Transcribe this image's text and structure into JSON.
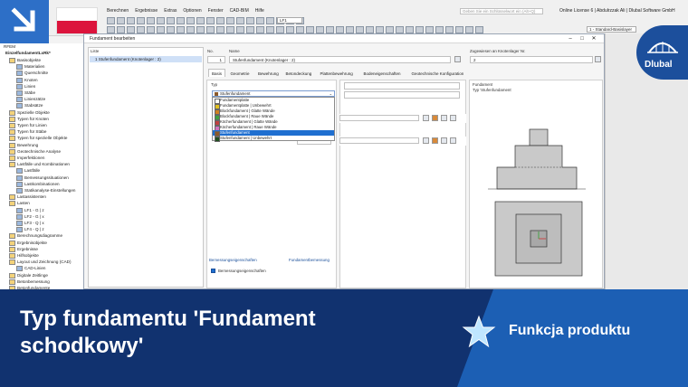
{
  "app": {
    "title": "RFEM",
    "menu": [
      "Berechnen",
      "Ergebnisse",
      "Extras",
      "Optionen",
      "Fenster",
      "CAD-BIM",
      "Hilfe"
    ],
    "search_placeholder": "Geben Sie ein Schlüsselwort ein (Alt+Q)",
    "licence": "Online License 6 | Abdulrzzak Ali | Dlubal Software GmbH",
    "loadcase": "LF1",
    "view_combo": "1 - Standard-Basislayer"
  },
  "colors": {
    "flag_white": "#ffffff",
    "flag_red": "#dc143c",
    "banner_dark": "#11326f",
    "banner_blue": "#1c5fb4",
    "selection": "#1f6fd0"
  },
  "navigator": {
    "root": "RFEM",
    "project": "EinzelfundamentLxRk*",
    "items": [
      {
        "label": "Basisobjekte",
        "level": 1
      },
      {
        "label": "Materialien",
        "level": 2
      },
      {
        "label": "Querschnitte",
        "level": 2
      },
      {
        "label": "Knoten",
        "level": 2
      },
      {
        "label": "Linien",
        "level": 2
      },
      {
        "label": "Stäbe",
        "level": 2
      },
      {
        "label": "Linienzätze",
        "level": 2
      },
      {
        "label": "Stabsätze",
        "level": 2
      },
      {
        "label": "Spezielle Objekte",
        "level": 1
      },
      {
        "label": "Typen für Knoten",
        "level": 1
      },
      {
        "label": "Typen für Linien",
        "level": 1
      },
      {
        "label": "Typen für Stäbe",
        "level": 1
      },
      {
        "label": "Typen für spezielle Objekte",
        "level": 1
      },
      {
        "label": "Bewehrung",
        "level": 1
      },
      {
        "label": "Geotechnische Analyse",
        "level": 1
      },
      {
        "label": "Imperfektionen",
        "level": 1
      },
      {
        "label": "Lastfälle und Kombinationen",
        "level": 1
      },
      {
        "label": "Lastfälle",
        "level": 2
      },
      {
        "label": "Bemessungssituationen",
        "level": 2
      },
      {
        "label": "Lastkombinationen",
        "level": 2
      },
      {
        "label": "Statikanalyse-Einstellungen",
        "level": 2
      },
      {
        "label": "Lastassistenten",
        "level": 1
      },
      {
        "label": "Lasten",
        "level": 1
      },
      {
        "label": "LF1 - G | z",
        "level": 2
      },
      {
        "label": "LF2 - G | x",
        "level": 2
      },
      {
        "label": "LF3 - Q | x",
        "level": 2
      },
      {
        "label": "LF4 - Q | z",
        "level": 2
      },
      {
        "label": "Berechnungsdiagramme",
        "level": 1
      },
      {
        "label": "Ergebnisobjekte",
        "level": 1
      },
      {
        "label": "Ergebnisse",
        "level": 1
      },
      {
        "label": "Hilfsobjekte",
        "level": 1
      },
      {
        "label": "Layout und Zeichnung (CAD)",
        "level": 1
      },
      {
        "label": "CAD-Linien",
        "level": 2
      },
      {
        "label": "Digitale Zeitlinge",
        "level": 1
      },
      {
        "label": "Betonbemessung",
        "level": 1
      },
      {
        "label": "Betonfundamente",
        "level": 1
      }
    ]
  },
  "dialog": {
    "title": "Fundament bearbeiten",
    "list_header": "Liste",
    "list_item": "1  Stufenfundament (Knotenlager : 2)",
    "no_label": "No.",
    "no_value": "1",
    "name_label": "Name",
    "name_value": "Stufenfundament (Knotenlager : 2)",
    "assigned_label": "Zugewiesen an Knotenlager Nr.",
    "assigned_value": "2",
    "tabs": [
      "Basis",
      "Geometrie",
      "Bewehrung",
      "Betondeckung",
      "Plattenbewehrung",
      "Bodeneigenschaften",
      "Geotechnische Konfiguration"
    ],
    "type_label": "Typ",
    "type_value": "Stufenfundament",
    "type_options": [
      {
        "label": "Fundamentplatte",
        "color": "#ffffff"
      },
      {
        "label": "Fundamentplatte | Unbewehrt",
        "color": "#e0c020"
      },
      {
        "label": "Blockfundament | Glatte Wände",
        "color": "#d08020"
      },
      {
        "label": "Blockfundament | Raue Wände",
        "color": "#40a040"
      },
      {
        "label": "Köcherfundament | Glatte Wände",
        "color": "#c04040"
      },
      {
        "label": "Köcherfundament | Raue Wände",
        "color": "#d070c0"
      },
      {
        "label": "Stufenfundament",
        "color": "#8b5a2b"
      },
      {
        "label": "Stufenfundament | Unbewehrt",
        "color": "#205020"
      }
    ],
    "selected_index": 6,
    "design_props_header": "Bemessungseigenschaften",
    "design_props_right": "Fundamentbemessung",
    "design_props_check": "Bemessungseigenschaften",
    "preview_title": "Fundament",
    "preview_subtitle": "Typ 'Stufenfundament'"
  },
  "banner": {
    "title": "Typ fundamentu 'Fundament schodkowy'",
    "feature": "Funkcja produktu",
    "logo": "Dlubal"
  }
}
